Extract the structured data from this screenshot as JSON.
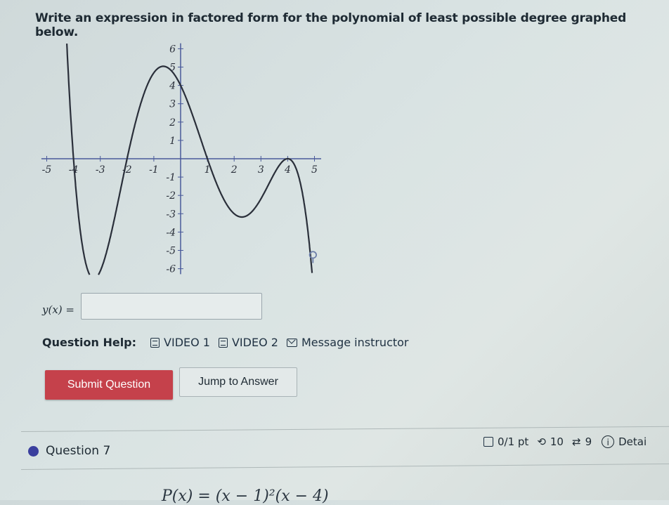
{
  "question": {
    "prompt": "Write an expression in factored form for the polynomial of least possible degree graphed below.",
    "answer_label": "y(x) =",
    "answer_value": "",
    "help_label": "Question Help:",
    "help_links": [
      {
        "label": "VIDEO 1",
        "icon": "document-icon"
      },
      {
        "label": "VIDEO 2",
        "icon": "document-icon"
      },
      {
        "label": "Message instructor",
        "icon": "mail-icon"
      }
    ],
    "submit_label": "Submit Question",
    "jump_label": "Jump to Answer"
  },
  "chart_data": {
    "type": "line",
    "x_ticks": [
      "-5",
      "-4",
      "-3",
      "-2",
      "-1",
      "1",
      "2",
      "3",
      "4",
      "5"
    ],
    "y_ticks": [
      "6",
      "5",
      "4",
      "3",
      "2",
      "1",
      "-1",
      "-2",
      "-3",
      "-4",
      "-5",
      "-6"
    ],
    "xlim": [
      -5,
      5
    ],
    "ylim": [
      -6,
      6
    ],
    "grid": false,
    "curve": {
      "roots": [
        -4,
        -2,
        1,
        4,
        4
      ],
      "leading_coefficient": -0.03125,
      "x_range": [
        -4.3,
        4.97
      ],
      "key_points": [
        {
          "x": -4,
          "y": 0
        },
        {
          "x": -3.4,
          "y": -6.3
        },
        {
          "x": -2,
          "y": 0
        },
        {
          "x": -0.7,
          "y": 5
        },
        {
          "x": 0,
          "y": 4
        },
        {
          "x": 1,
          "y": 0
        },
        {
          "x": 2.3,
          "y": -3.2
        },
        {
          "x": 4,
          "y": 0
        }
      ]
    },
    "color": "#2a2f3a",
    "axis_color": "#4a5a9a"
  },
  "next_question": {
    "title": "Question 7",
    "points": "0/1 pt",
    "retries": "10",
    "attempts": "9",
    "details": "Detai",
    "formula": "P(x) = (x − 1)²(x − 4)"
  }
}
